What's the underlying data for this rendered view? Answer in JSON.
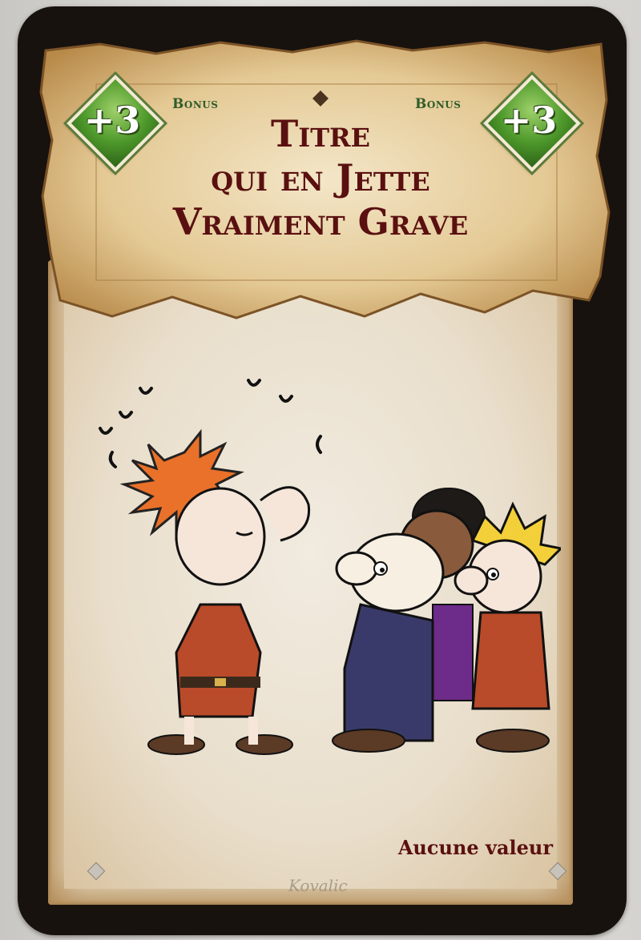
{
  "card": {
    "title_lines": [
      "Titre",
      "qui en Jette",
      "Vraiment Grave"
    ],
    "bonus_left": {
      "value": "+3",
      "label": "Bonus"
    },
    "bonus_right": {
      "value": "+3",
      "label": "Bonus"
    },
    "value_text": "Aucune valeur",
    "artist_signature": "Kovalic"
  },
  "illustration": {
    "description_icon": "cartoon-characters-illustration",
    "characters": [
      "red-haired-boy",
      "dark-haired-boy",
      "bald-man",
      "blond-boy"
    ]
  },
  "colors": {
    "card_border": "#17120e",
    "parchment": "#e8dcc3",
    "title_text": "#5a1010",
    "bonus_green": "#4f9a2c",
    "bonus_label": "#2f5c2a"
  }
}
